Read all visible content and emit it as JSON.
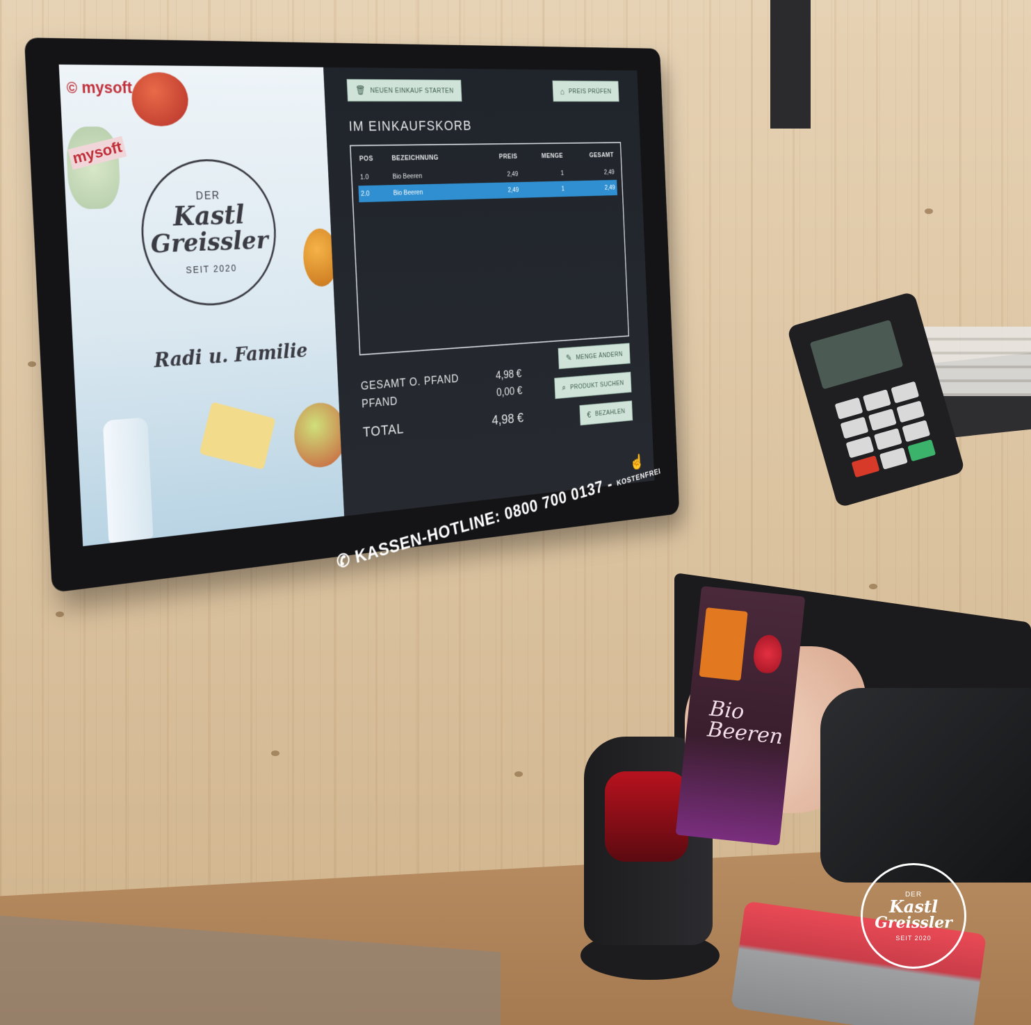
{
  "promo": {
    "brand": "mysoft",
    "badge": {
      "der": "DER",
      "kastl": "Kastl",
      "greissler": "Greissler",
      "seit": "SEIT 2020"
    },
    "tagline": "Radi u. Familie"
  },
  "pos": {
    "new_purchase_button": "NEUEN EINKAUF STARTEN",
    "top_right_button": "PREIS PRÜFEN",
    "basket_title": "IM EINKAUFSKORB",
    "table": {
      "headers": [
        "POS",
        "BEZEICHNUNG",
        "PREIS",
        "MENGE",
        "GESAMT"
      ],
      "rows": [
        {
          "pos": "1.0",
          "name": "Bio Beeren",
          "price": "2,49",
          "qty": "1",
          "total": "2,49",
          "selected": false
        },
        {
          "pos": "2.0",
          "name": "Bio Beeren",
          "price": "2,49",
          "qty": "1",
          "total": "2,49",
          "selected": true
        }
      ]
    },
    "totals": {
      "label_gesamt": "GESAMT O. PFAND",
      "label_pfand": "PFAND",
      "value_gesamt": "4,98 €",
      "value_pfand": "0,00 €",
      "label_total": "TOTAL",
      "value_total": "4,98 €"
    },
    "side_buttons": {
      "change_qty": "MENGE ÄNDERN",
      "search_product": "PRODUKT SUCHEN",
      "pay": "BEZAHLEN"
    },
    "accent_color": "#2f8fd0"
  },
  "hotline": {
    "label": "KASSEN-HOTLINE: 0800 700 0137 -",
    "suffix": "KOSTENFREI"
  },
  "scanner_label": "mysoft",
  "product": {
    "name": "Bio Beeren"
  },
  "watermark": {
    "der": "DER",
    "kastl": "Kastl",
    "greissler": "Greissler",
    "seit": "SEIT 2020"
  }
}
